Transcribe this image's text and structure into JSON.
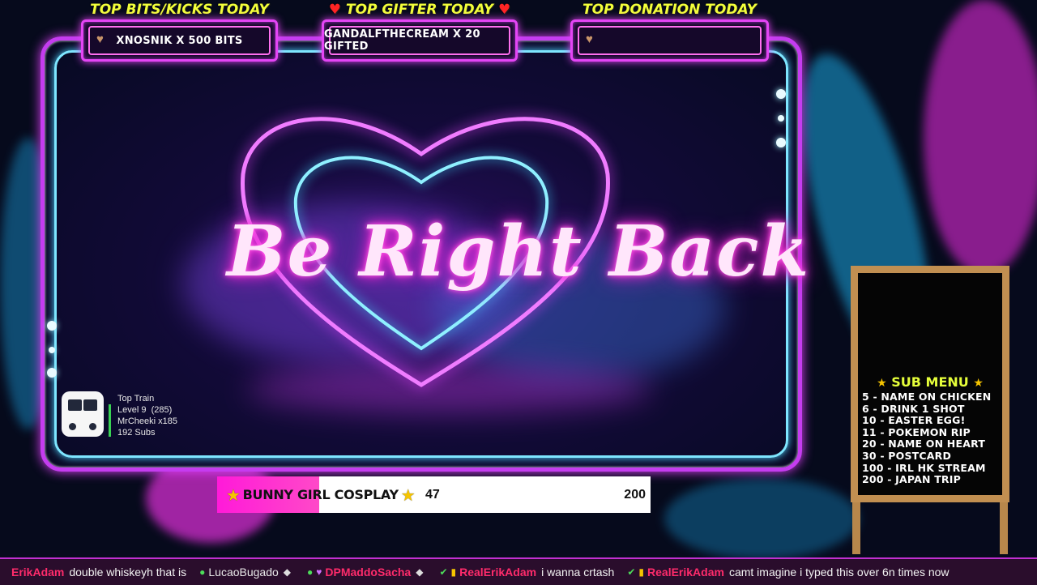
{
  "top_boxes": [
    {
      "title": "TOP BITS/KICKS TODAY",
      "value": "XNOSNIK X 500 BITS"
    },
    {
      "title": "TOP GIFTER TODAY",
      "value": "GANDALFTHECREAM X 20 GIFTED"
    },
    {
      "title": "TOP DONATION TODAY",
      "value": ""
    }
  ],
  "brb_text": "Be Right Back",
  "top_train": {
    "title": "Top Train",
    "level": "Level 9  (285)",
    "user": "MrCheeki x185",
    "subs": "192 Subs"
  },
  "goal": {
    "label": "BUNNY GIRL COSPLAY",
    "current": "47",
    "target": "200",
    "progress": 0.235
  },
  "sub_menu": {
    "title": "SUB MENU",
    "items": [
      "5 - NAME ON CHICKEN",
      "6 - DRINK 1 SHOT",
      "10 - EASTER EGG!",
      "11 - POKEMON RIP",
      "20 - NAME ON HEART",
      "30 - POSTCARD",
      "100 - IRL HK STREAM",
      "200 - JAPAN TRIP"
    ]
  },
  "chat": [
    {
      "user": "ErikAdam",
      "text": "double whiskeyh that is",
      "user_color": "#ff2b6b"
    },
    {
      "user": "LucaoBugado",
      "text": "",
      "user_color": "#e8e8e8"
    },
    {
      "user": "DPMaddoSacha",
      "text": "",
      "user_color": "#ff2b6b"
    },
    {
      "user": "RealErikAdam",
      "text": "i wanna crtash",
      "user_color": "#ff2b6b"
    },
    {
      "user": "RealErikAdam",
      "text": "camt imagine i typed this over 6n times now",
      "user_color": "#ff2b6b"
    }
  ],
  "colors": {
    "neon_pink": "#e445f5",
    "neon_cyan": "#7ee6ff",
    "title_yellow": "#f2ff3a",
    "goal_pink": "#ff1ad9"
  }
}
